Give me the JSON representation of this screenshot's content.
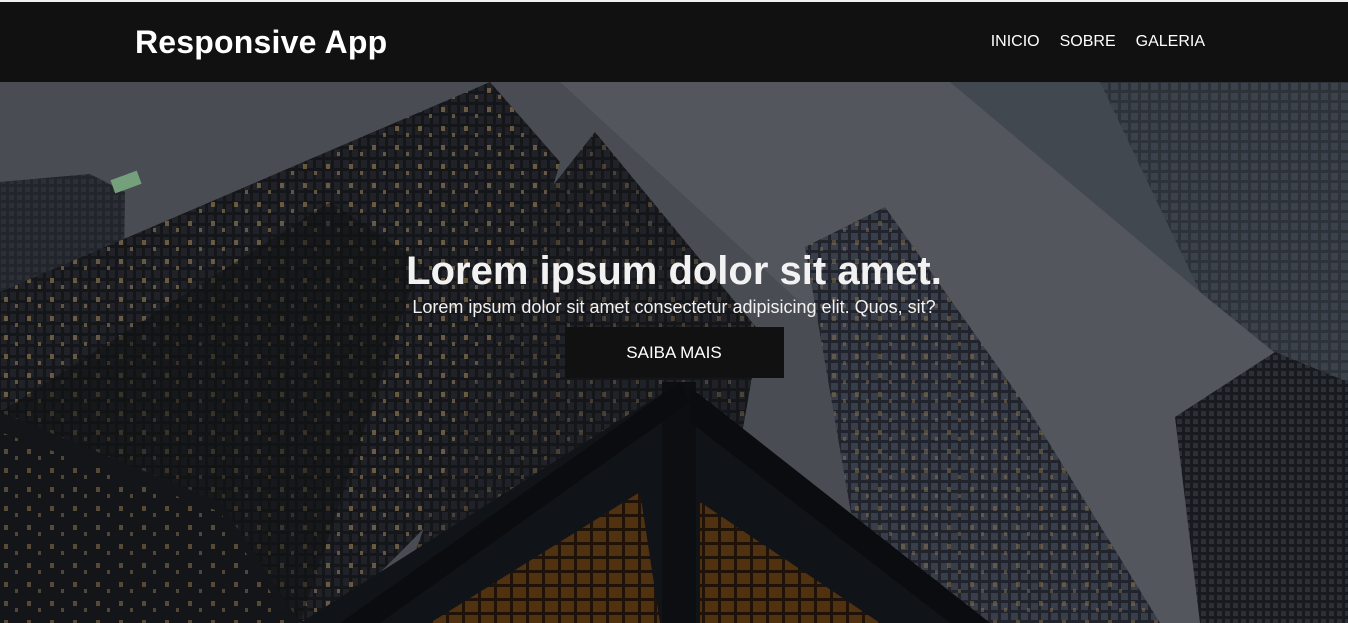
{
  "navbar": {
    "brand": "Responsive App",
    "links": [
      "INICIO",
      "SOBRE",
      "GALERIA"
    ]
  },
  "hero": {
    "title": "Lorem ipsum dolor sit amet.",
    "subtitle": "Lorem ipsum dolor sit amet consectetur adipisicing elit. Quos, sit?",
    "cta_label": "SAIBA MAIS"
  },
  "colors": {
    "navbar_bg": "#111111",
    "text": "#ffffff",
    "button_bg": "#111111"
  }
}
